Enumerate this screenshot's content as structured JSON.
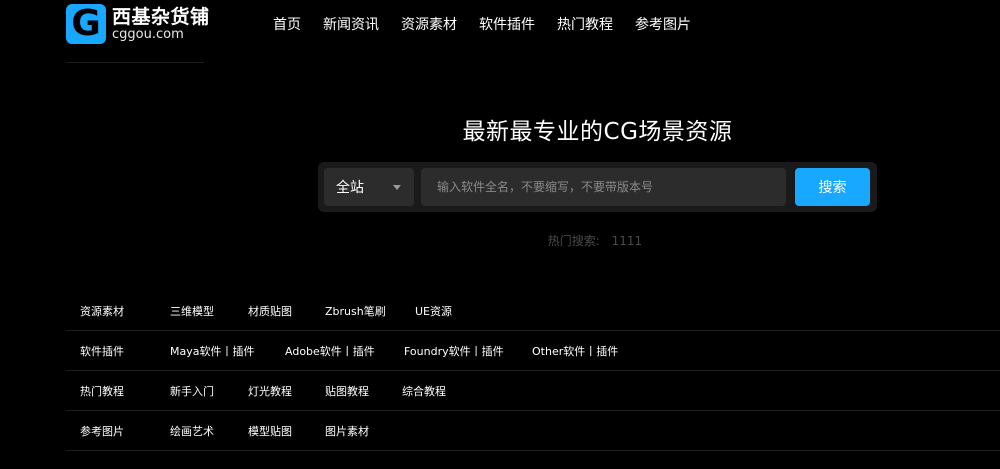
{
  "logo": {
    "mark_letter": "G",
    "name": "西基杂货铺",
    "domain": "cggou.com",
    "colors": {
      "brand": "#18a8ff"
    }
  },
  "nav": {
    "items": [
      "首页",
      "新闻资讯",
      "资源素材",
      "软件插件",
      "热门教程",
      "参考图片"
    ]
  },
  "hero": {
    "title": "最新最专业的CG场景资源"
  },
  "search": {
    "scope": "全站",
    "placeholder": "输入软件全名，不要缩写，不要带版本号",
    "button_label": "搜索"
  },
  "hot_search": {
    "label": "热门搜索:",
    "keyword": "1111"
  },
  "categories": [
    {
      "head": "资源素材",
      "items": [
        "三维模型",
        "材质贴图",
        "Zbrush笔刷",
        "UE资源"
      ]
    },
    {
      "head": "软件插件",
      "items": [
        "Maya软件丨插件",
        "Adobe软件丨插件",
        "Foundry软件丨插件",
        "Other软件丨插件"
      ]
    },
    {
      "head": "热门教程",
      "items": [
        "新手入门",
        "灯光教程",
        "贴图教程",
        "综合教程"
      ]
    },
    {
      "head": "参考图片",
      "items": [
        "绘画艺术",
        "模型贴图",
        "图片素材"
      ]
    }
  ]
}
